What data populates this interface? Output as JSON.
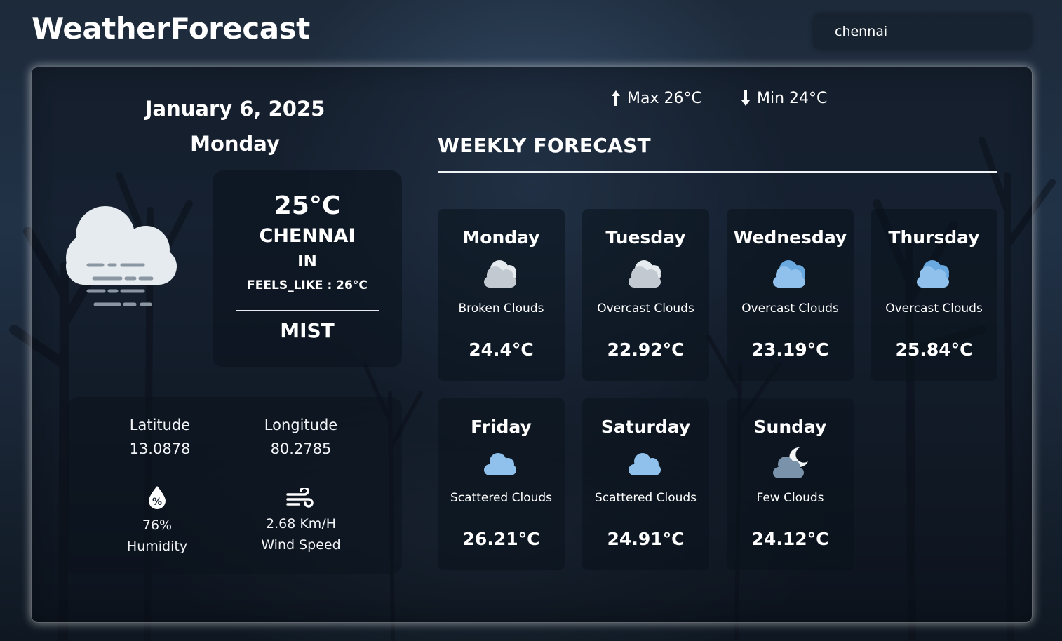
{
  "app": {
    "title": "WeatherForecast"
  },
  "search": {
    "value": "chennai",
    "placeholder": ""
  },
  "current": {
    "date": "January 6, 2025",
    "day": "Monday",
    "icon": "mist-cloud-icon",
    "temperature": "25°C",
    "city": "CHENNAI",
    "country": "IN",
    "feels_like": "FEELS_LIKE : 26°C",
    "condition": "MIST"
  },
  "details": {
    "latitude_label": "Latitude",
    "latitude_value": "13.0878",
    "longitude_label": "Longitude",
    "longitude_value": "80.2785",
    "humidity_value": "76%",
    "humidity_label": "Humidity",
    "wind_value": "2.68 Km/H",
    "wind_label": "Wind Speed"
  },
  "minmax": {
    "max": "Max 26°C",
    "min": "Min 24°C"
  },
  "weekly": {
    "title": "WEEKLY FORECAST",
    "days": [
      {
        "day": "Monday",
        "icon": "broken-clouds-icon",
        "desc": "Broken Clouds",
        "temp": "24.4°C"
      },
      {
        "day": "Tuesday",
        "icon": "overcast-clouds-icon",
        "desc": "Overcast Clouds",
        "temp": "22.92°C"
      },
      {
        "day": "Wednesday",
        "icon": "overcast-clouds-icon",
        "desc": "Overcast Clouds",
        "temp": "23.19°C"
      },
      {
        "day": "Thursday",
        "icon": "overcast-clouds-icon",
        "desc": "Overcast Clouds",
        "temp": "25.84°C"
      },
      {
        "day": "Friday",
        "icon": "scattered-clouds-icon",
        "desc": "Scattered Clouds",
        "temp": "26.21°C"
      },
      {
        "day": "Saturday",
        "icon": "scattered-clouds-icon",
        "desc": "Scattered Clouds",
        "temp": "24.91°C"
      },
      {
        "day": "Sunday",
        "icon": "few-clouds-night-icon",
        "desc": "Few Clouds",
        "temp": "24.12°C"
      }
    ]
  },
  "colors": {
    "cloud_white": "#e6ebf0",
    "cloud_gray": "#c3c9d0",
    "cloud_blue": "#8fc1ec",
    "mist_lines": "#8b96a3",
    "moon": "#f2f4f6",
    "night_cloud": "#7a93ab"
  }
}
